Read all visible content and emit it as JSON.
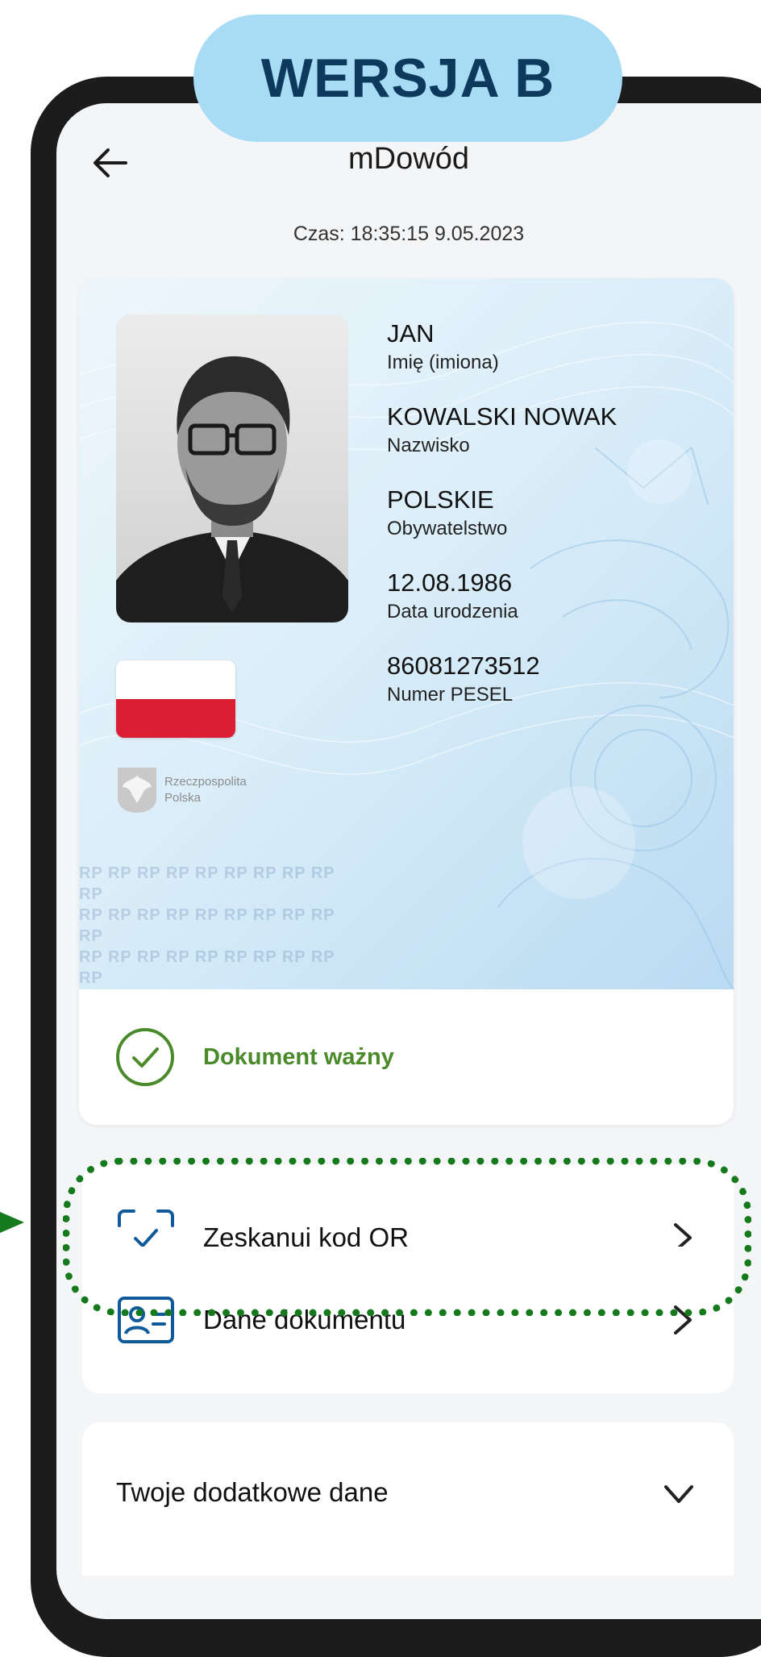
{
  "badge": {
    "text": "WERSJA B"
  },
  "header": {
    "title": "mDowód",
    "back_icon": "arrow-left-icon"
  },
  "timestamp": "Czas: 18:35:15 9.05.2023",
  "card": {
    "fields": [
      {
        "value": "JAN",
        "label": "Imię (imiona)"
      },
      {
        "value": "KOWALSKI NOWAK",
        "label": "Nazwisko"
      },
      {
        "value": "POLSKIE",
        "label": "Obywatelstwo"
      },
      {
        "value": "12.08.1986",
        "label": "Data urodzenia"
      },
      {
        "value": "86081273512",
        "label": "Numer PESEL"
      }
    ],
    "emblem_text": [
      "Rzeczpospolita",
      "Polska"
    ],
    "rp_pattern": "RP RP RP RP RP RP RP RP RP RP",
    "status": {
      "text": "Dokument ważny",
      "icon": "check-circle-icon",
      "color": "#4b8a2b"
    }
  },
  "menu": [
    {
      "label": "Zeskanuj kod QR",
      "icon": "qr-scan-icon"
    },
    {
      "label": "Dane dokumentu",
      "icon": "id-card-icon"
    }
  ],
  "extra_section": {
    "label": "Twoje dodatkowe dane",
    "icon": "chevron-down-icon"
  },
  "colors": {
    "accent_blue": "#0f5a9a",
    "highlight_green": "#157a1b",
    "badge_bg": "#a8dcf5",
    "badge_text": "#0d3a5c"
  }
}
